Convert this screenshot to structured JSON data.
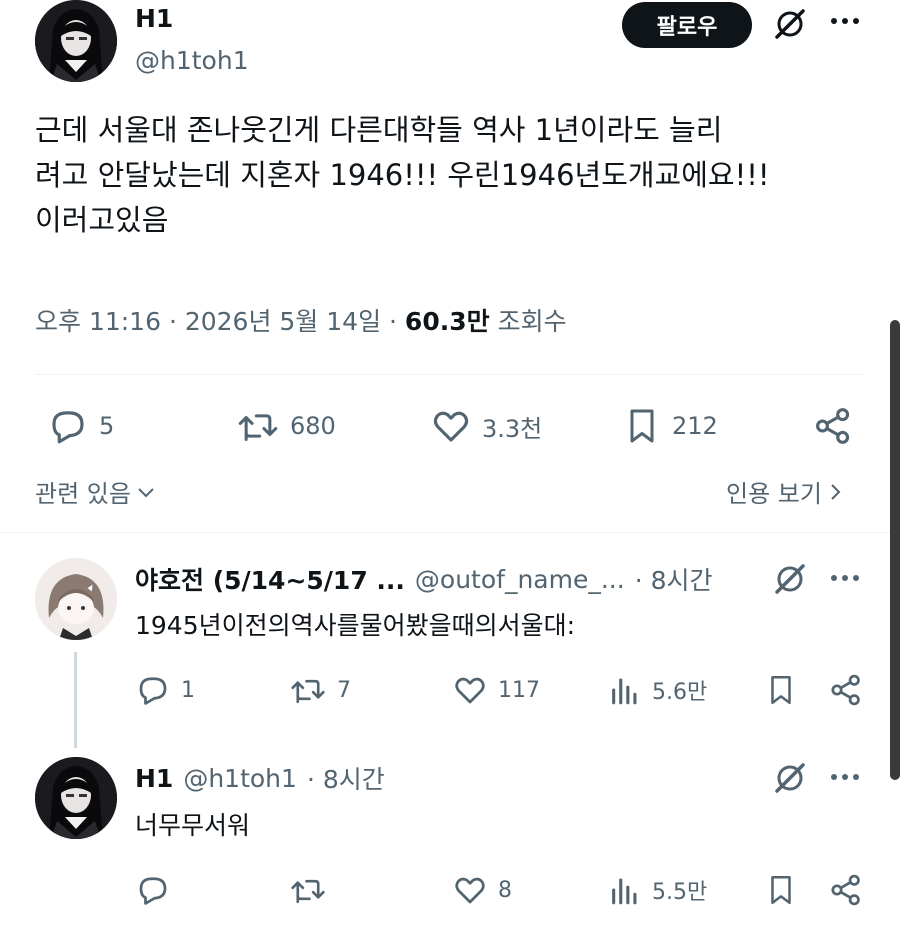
{
  "main_tweet": {
    "author_name": "H1",
    "handle": "@h1toh1",
    "follow_label": "팔로우",
    "text": "근데 서울대 존나웃긴게 다른대학들 역사 1년이라도 늘리\n려고 안달났는데 지혼자 1946!!! 우린1946년도개교에요!!!\n이러고있음",
    "time": "오후 11:16 · 2026년 5월 14일 · ",
    "views_count": "60.3만",
    "views_label": "조회수",
    "actions": {
      "replies": "5",
      "retweets": "680",
      "likes": "3.3천",
      "bookmarks": "212"
    }
  },
  "related": {
    "left_label": "관련 있음",
    "right_label": "인용 보기"
  },
  "replies": [
    {
      "author_name": "야호전 (5/14~5/17 ...",
      "handle": "@outof_name_...",
      "time": "· 8시간",
      "text": "1945년이전의역사를물어봤을때의서울대:",
      "actions": {
        "replies": "1",
        "retweets": "7",
        "likes": "117",
        "views": "5.6만"
      }
    },
    {
      "author_name": "H1",
      "handle": "@h1toh1",
      "time": "· 8시간",
      "text": "너무무서워",
      "actions": {
        "replies": "",
        "retweets": "",
        "likes": "8",
        "views": "5.5만"
      }
    }
  ],
  "icons": [
    "grok-icon",
    "more-icon",
    "reply-icon",
    "retweet-icon",
    "like-icon",
    "bookmark-icon",
    "share-icon",
    "views-icon",
    "chevron-down-icon",
    "chevron-right-icon"
  ],
  "colors": {
    "text": "#0f1419",
    "muted": "#536471",
    "divider": "#eff3f4",
    "button": "#0f1419"
  }
}
